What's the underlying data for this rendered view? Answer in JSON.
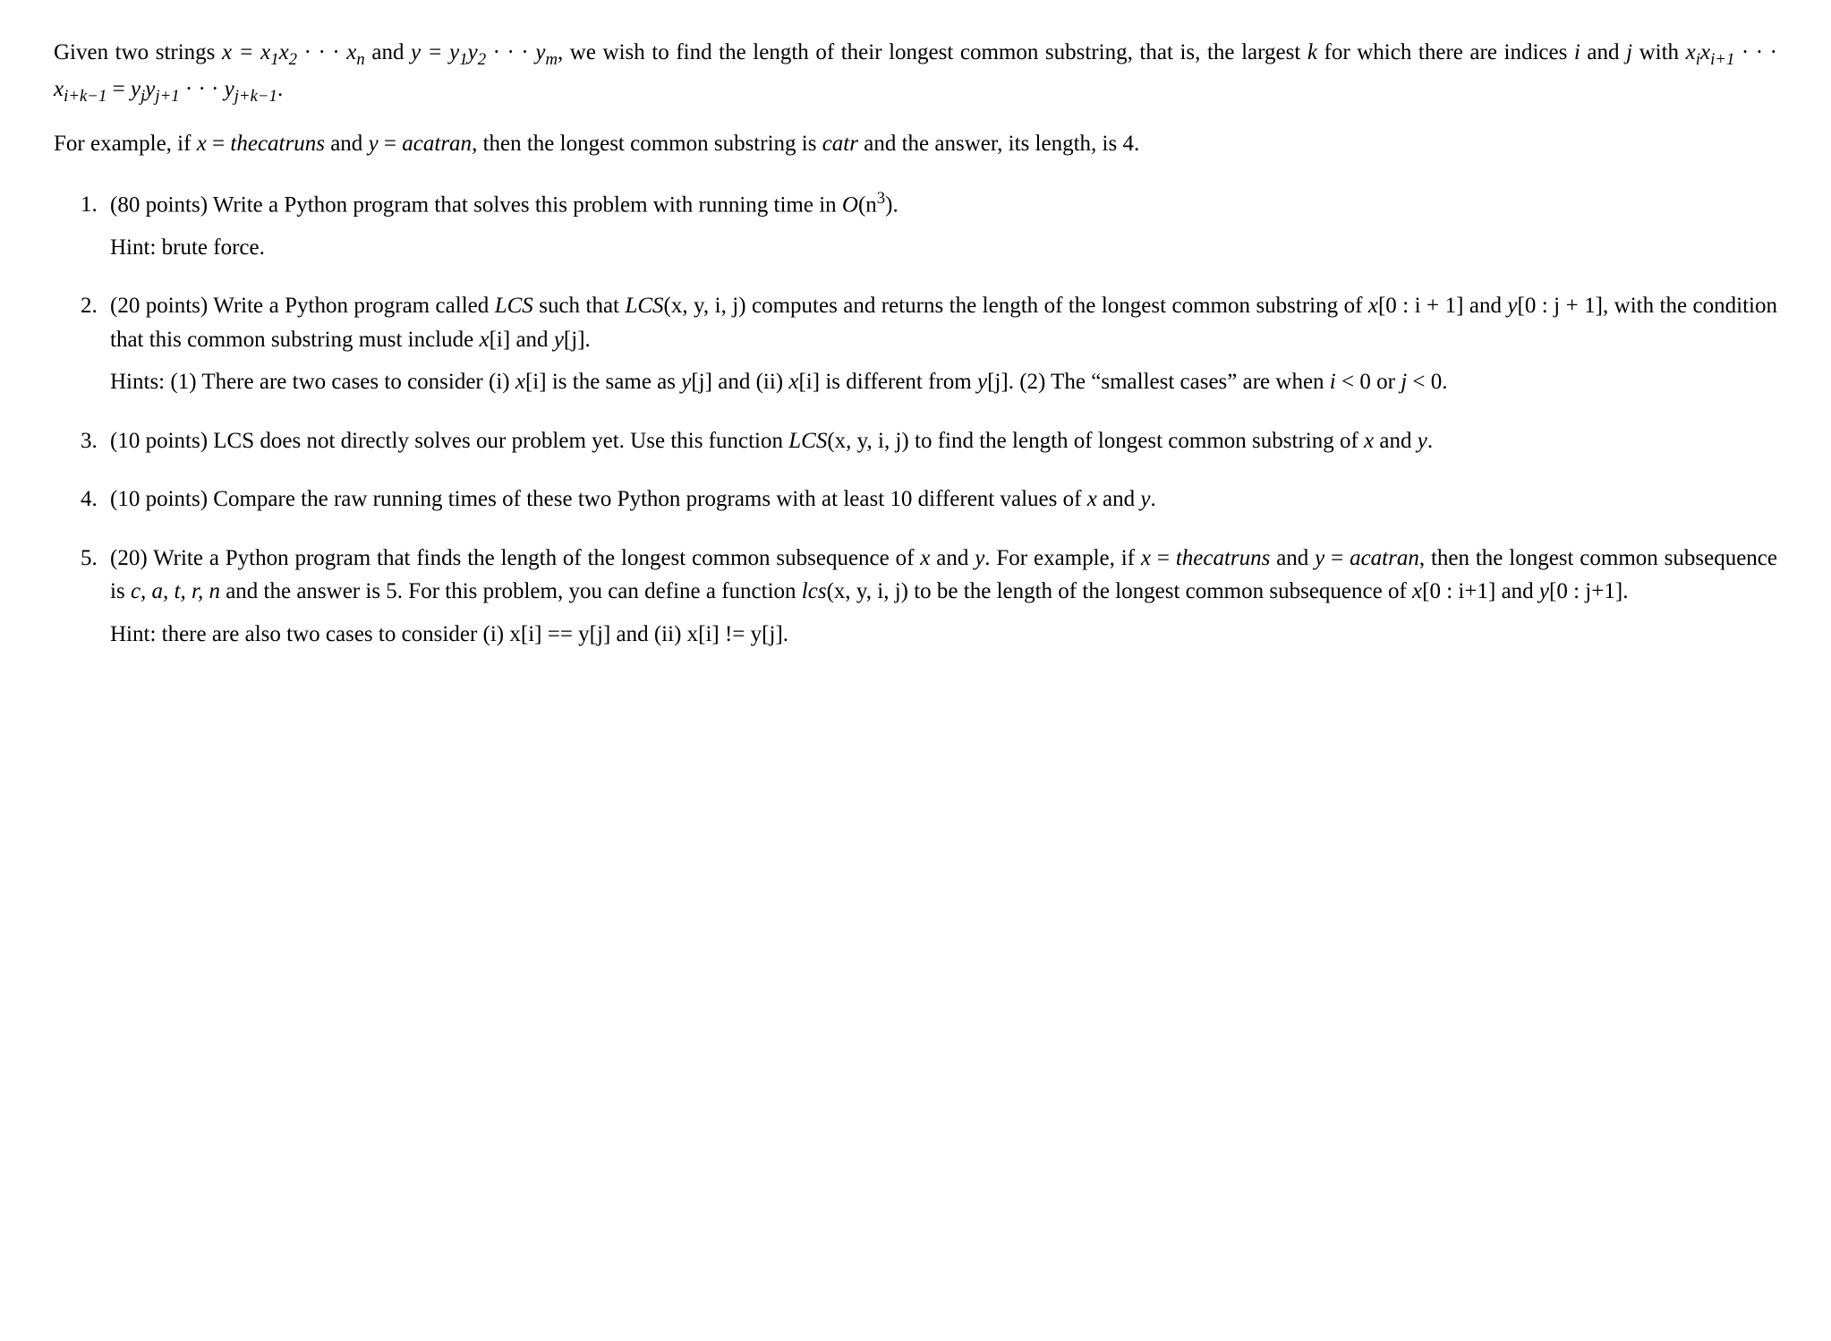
{
  "intro": {
    "p1_prefix": "Given two strings ",
    "x_eq": "x = x",
    "x_sub1": "1",
    "x_part2": "x",
    "x_sub2": "2",
    "dots": " · · · ",
    "xn": "x",
    "xn_sub": "n",
    "and1": " and ",
    "y_eq": "y = y",
    "y_sub1": "1",
    "y_part2": "y",
    "y_sub2": "2",
    "ym": "y",
    "ym_sub": "m",
    "p1_mid": ", we wish to find the length of their longest common substring, that is, the largest ",
    "k": "k",
    "p1_mid2": " for which there are indices ",
    "i": "i",
    "and2": " and ",
    "j": "j",
    "with": " with ",
    "xi": "x",
    "xi_sub": "i",
    "xi1": "x",
    "xi1_sub": "i+1",
    "xik": "x",
    "xik_sub": "i+k−1",
    "eq": " = ",
    "yj": "y",
    "yj_sub": "j",
    "yj1": "y",
    "yj1_sub": "j+1",
    "yjk": "y",
    "yjk_sub": "j+k−1",
    "period": ".",
    "p2_prefix": "For example, if ",
    "x2": "x",
    "eq2": " = ",
    "thecatruns": "thecatruns",
    "and3": " and ",
    "y2": "y",
    "acatran": "acatran",
    "p2_mid": ", then the longest common substring is ",
    "catr": "catr",
    "p2_end": " and the answer, its length, is 4."
  },
  "items": {
    "1": {
      "pts": "(80 points) ",
      "text": "Write a Python program that solves this problem with running time in ",
      "bigO_pre": "O",
      "bigO_inner": "(n",
      "bigO_sup": "3",
      "bigO_end": ")",
      "period": ".",
      "hint": "Hint: brute force."
    },
    "2": {
      "pts": "(20 points) ",
      "t1": "Write a Python program called ",
      "lcs1": "LCS",
      "t2": " such that ",
      "lcs2": "LCS",
      "args": "(x, y, i, j)",
      "t3": " computes and returns the length of the longest common substring of ",
      "x0i": "x",
      "x0i_br": "[0 : i + 1]",
      "and": " and ",
      "y0j": "y",
      "y0j_br": "[0 : j + 1]",
      "t4": ", with the condition that this common substring must include ",
      "xi": "x",
      "xi_br": "[i]",
      "and2": " and ",
      "yj": "y",
      "yj_br": "[j]",
      "period": ".",
      "hint_pre": "Hints: (1) There are two cases to consider (i) ",
      "h_xi": "x",
      "h_xi_br": "[i]",
      "h_same": " is the same as ",
      "h_yj": "y",
      "h_yj_br": "[j]",
      "h_and_ii": " and (ii) ",
      "h_xi2": "x",
      "h_xi2_br": "[i]",
      "h_diff": " is different from ",
      "h_yj2": "y",
      "h_yj2_br": "[j]",
      "h_2": ". (2) The “smallest cases” are when ",
      "h_i": "i",
      "h_lt1": " < 0 or ",
      "h_j": "j",
      "h_lt2": " < 0."
    },
    "3": {
      "pts": "(10 points) ",
      "t1": "LCS does not directly solves our problem yet. Use this function ",
      "lcs": "LCS",
      "args": "(x, y, i, j)",
      "t2": " to find the length of longest common substring of ",
      "x": "x",
      "and": " and ",
      "y": "y",
      "period": "."
    },
    "4": {
      "pts": "(10 points) ",
      "t1": "Compare the raw running times of these two Python programs with at least 10 different values of ",
      "x": "x",
      "and": " and ",
      "y": "y",
      "period": "."
    },
    "5": {
      "pts": "(20) ",
      "t1": "Write a Python program that finds the length of the longest common subsequence of ",
      "x": "x",
      "and1": " and ",
      "y": "y",
      "t2": ". For example, if ",
      "x2": "x",
      "eq1": " = ",
      "thecatruns": "thecatruns",
      "and2": " and ",
      "y2": "y",
      "eq2": " = ",
      "acatran": "acatran",
      "t3": ", then the longest common subsequence is ",
      "seq": "c, a, t, r, n",
      "t4": " and the answer is 5. For this problem, you can define a function ",
      "lcsf": "lcs",
      "lcsf_args": "(x, y, i, j)",
      "t5": " to be the length of the longest common subsequence of ",
      "x0i": "x",
      "x0i_br": "[0 : i+1]",
      "and3": " and ",
      "y0j": "y",
      "y0j_br": "[0 : j+1]",
      "period": ".",
      "hint": "Hint: there are also two cases to consider (i) x[i] == y[j] and (ii) x[i] != y[j]."
    }
  }
}
